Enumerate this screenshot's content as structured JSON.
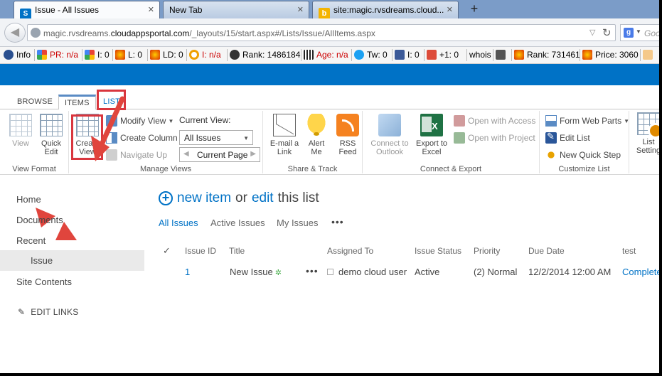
{
  "browser": {
    "tabs": [
      {
        "label": "Issue - All Issues",
        "favicon": "sharepoint-icon",
        "active": true
      },
      {
        "label": "New Tab",
        "favicon": "",
        "active": false
      },
      {
        "label": "site:magic.rvsdreams.cloud...",
        "favicon": "bing-icon",
        "active": false
      }
    ],
    "new_tab_symbol": "+",
    "close_symbol": "✕",
    "url_prefix": "magic.rvsdreams.",
    "url_domain": "cloudappsportal.com",
    "url_path": "/_layouts/15/start.aspx#/Lists/Issue/AllItems.aspx",
    "search_placeholder": "Goo"
  },
  "seo_toolbar": [
    {
      "icon": "info-icon",
      "label": "Info",
      "red": false
    },
    {
      "icon": "google-pr-icon",
      "label": "PR: n/a",
      "red": true
    },
    {
      "icon": "google-index-icon",
      "label": "I: 0",
      "red": false
    },
    {
      "icon": "flame-icon",
      "label": "L: 0",
      "red": false
    },
    {
      "icon": "flame-icon",
      "label": "LD: 0",
      "red": false
    },
    {
      "icon": "ring-icon",
      "label": "I: n/a",
      "red": true
    },
    {
      "icon": "alexa-icon",
      "label": "Rank: 1486184",
      "red": false
    },
    {
      "icon": "archive-icon",
      "label": "Age: n/a",
      "red": true
    },
    {
      "icon": "twitter-icon",
      "label": "Tw: 0",
      "red": false
    },
    {
      "icon": "facebook-icon",
      "label": "I: 0",
      "red": false
    },
    {
      "icon": "gplus-icon",
      "label": "+1: 0",
      "red": false
    },
    {
      "icon": "",
      "label": "whois",
      "red": false
    },
    {
      "icon": "source-code-icon",
      "label": "",
      "red": false
    },
    {
      "icon": "flame-icon",
      "label": "Rank: 731461",
      "red": false
    },
    {
      "icon": "flame-icon",
      "label": "Price: 3060",
      "red": false
    },
    {
      "icon": "hand-icon",
      "label": "",
      "red": false
    }
  ],
  "ribbon_tabs": [
    "BROWSE",
    "ITEMS",
    "LIST"
  ],
  "ribbon": {
    "view_format": {
      "label": "View Format",
      "view": "View",
      "quick_edit": "Quick\nEdit"
    },
    "manage_views": {
      "label": "Manage Views",
      "create_view": "Create\nView",
      "modify_view": "Modify View",
      "create_column": "Create Column",
      "navigate_up": "Navigate Up",
      "current_view_label": "Current View:",
      "current_view_value": "All Issues",
      "current_page": "Current Page"
    },
    "share_track": {
      "label": "Share & Track",
      "email_link": "E-mail a\nLink",
      "alert_me": "Alert\nMe",
      "rss_feed": "RSS\nFeed"
    },
    "connect_export": {
      "label": "Connect & Export",
      "connect_outlook": "Connect to\nOutlook",
      "export_excel": "Export to\nExcel",
      "open_access": "Open with Access",
      "open_project": "Open with Project"
    },
    "customize_list": {
      "label": "Customize List",
      "form_web_parts": "Form Web Parts",
      "edit_list": "Edit List",
      "new_quick_step": "New Quick Step"
    },
    "list_settings": "List\nSetting"
  },
  "left_nav": {
    "items": [
      "Home",
      "Documents",
      "Recent",
      "Site Contents"
    ],
    "recent_sub": "Issue",
    "edit_links": "EDIT LINKS"
  },
  "main": {
    "new_item": "new item",
    "or": "or",
    "edit": "edit",
    "this_list": "this list",
    "views": [
      "All Issues",
      "Active Issues",
      "My Issues"
    ],
    "views_more": "•••",
    "columns": [
      "Issue ID",
      "Title",
      "Assigned To",
      "Issue Status",
      "Priority",
      "Due Date",
      "test"
    ],
    "row": {
      "issue_id": "1",
      "title": "New Issue",
      "new_marker": "✲",
      "more": "•••",
      "assigned_to": "demo cloud user",
      "status": "Active",
      "priority": "(2) Normal",
      "due_date": "12/2/2014 12:00 AM",
      "test": "Complete"
    }
  },
  "colors": {
    "suite_bar": "#0072c6",
    "link": "#0072c6",
    "highlight": "#d9363e"
  }
}
